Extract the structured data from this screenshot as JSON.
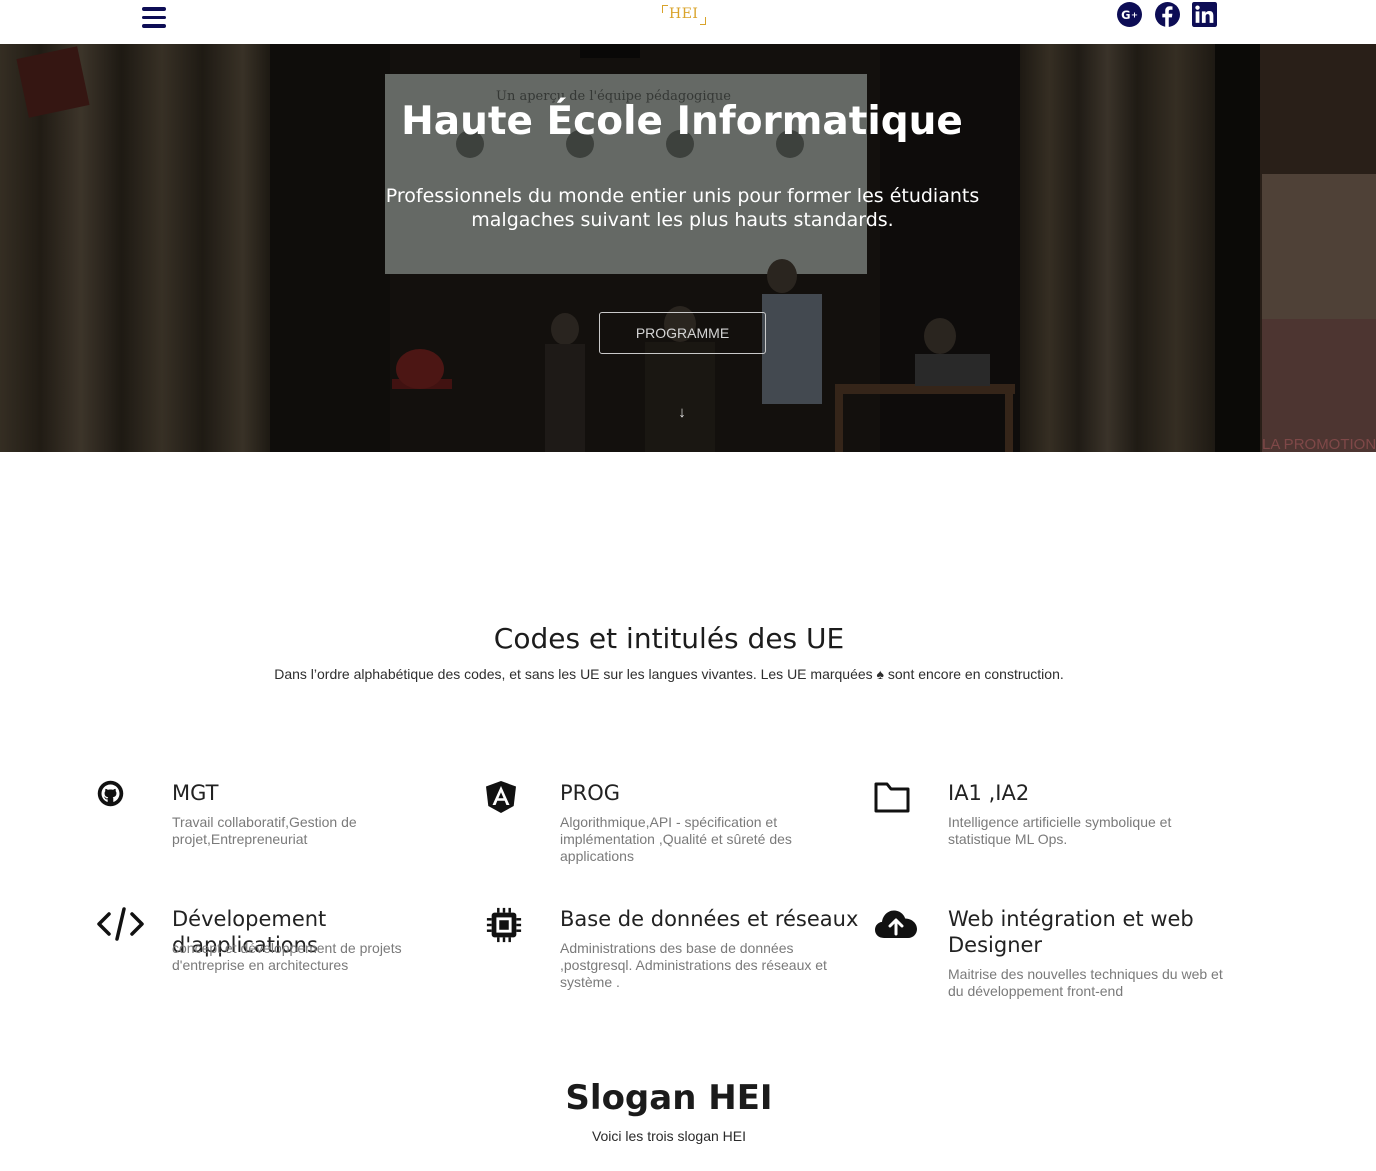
{
  "header": {
    "logo_text": "HEI",
    "social": [
      {
        "icon": "google-plus-icon"
      },
      {
        "icon": "facebook-icon"
      },
      {
        "icon": "linkedin-icon"
      }
    ],
    "icon_color": "#0d0d55",
    "logo_color": "#d9a32a"
  },
  "hero": {
    "title": "Haute École Informatique",
    "subtitle": "Professionnels du monde entier unis pour former les étudiants malgaches suivant les plus hauts standards.",
    "button_label": "PROGRAMME",
    "scroll_arrow": "↓",
    "background_text": {
      "screen": "Un aperçu de l'équipe pédagogique",
      "banner": "LA PROMOTION"
    }
  },
  "ue_section": {
    "title": "Codes et intitulés des UE",
    "subtitle": "Dans l’ordre alphabétique des codes, et sans les UE sur les langues vivantes. Les UE marquées ♠ sont encore en construction.",
    "items": [
      {
        "icon": "github-icon",
        "title": "MGT",
        "description": "Travail collaboratif,Gestion de projet,Entrepreneuriat"
      },
      {
        "icon": "angular-icon",
        "title": "PROG",
        "description": "Algorithmique,API - spécification et implémentation ,Qualité et sûreté des applications"
      },
      {
        "icon": "folder-icon",
        "title": "IA1 ,IA2",
        "description": "Intelligence artificielle symbolique et statistique ML Ops."
      },
      {
        "icon": "code-icon",
        "title": "Dévelopement d'applications",
        "description": "concept et développement de projets d'entreprise en architectures"
      },
      {
        "icon": "cpu-chip-icon",
        "title": "Base de données et réseaux",
        "description": "Administrations des base de données ,postgresql. Administrations des réseaux et système ."
      },
      {
        "icon": "cloud-upload-icon",
        "title": "Web intégration et web Designer",
        "description": "Maitrise des nouvelles techniques du web et du développement front-end"
      }
    ]
  },
  "slogan_section": {
    "title": "Slogan HEI",
    "subtitle": "Voici les trois slogan HEI"
  }
}
